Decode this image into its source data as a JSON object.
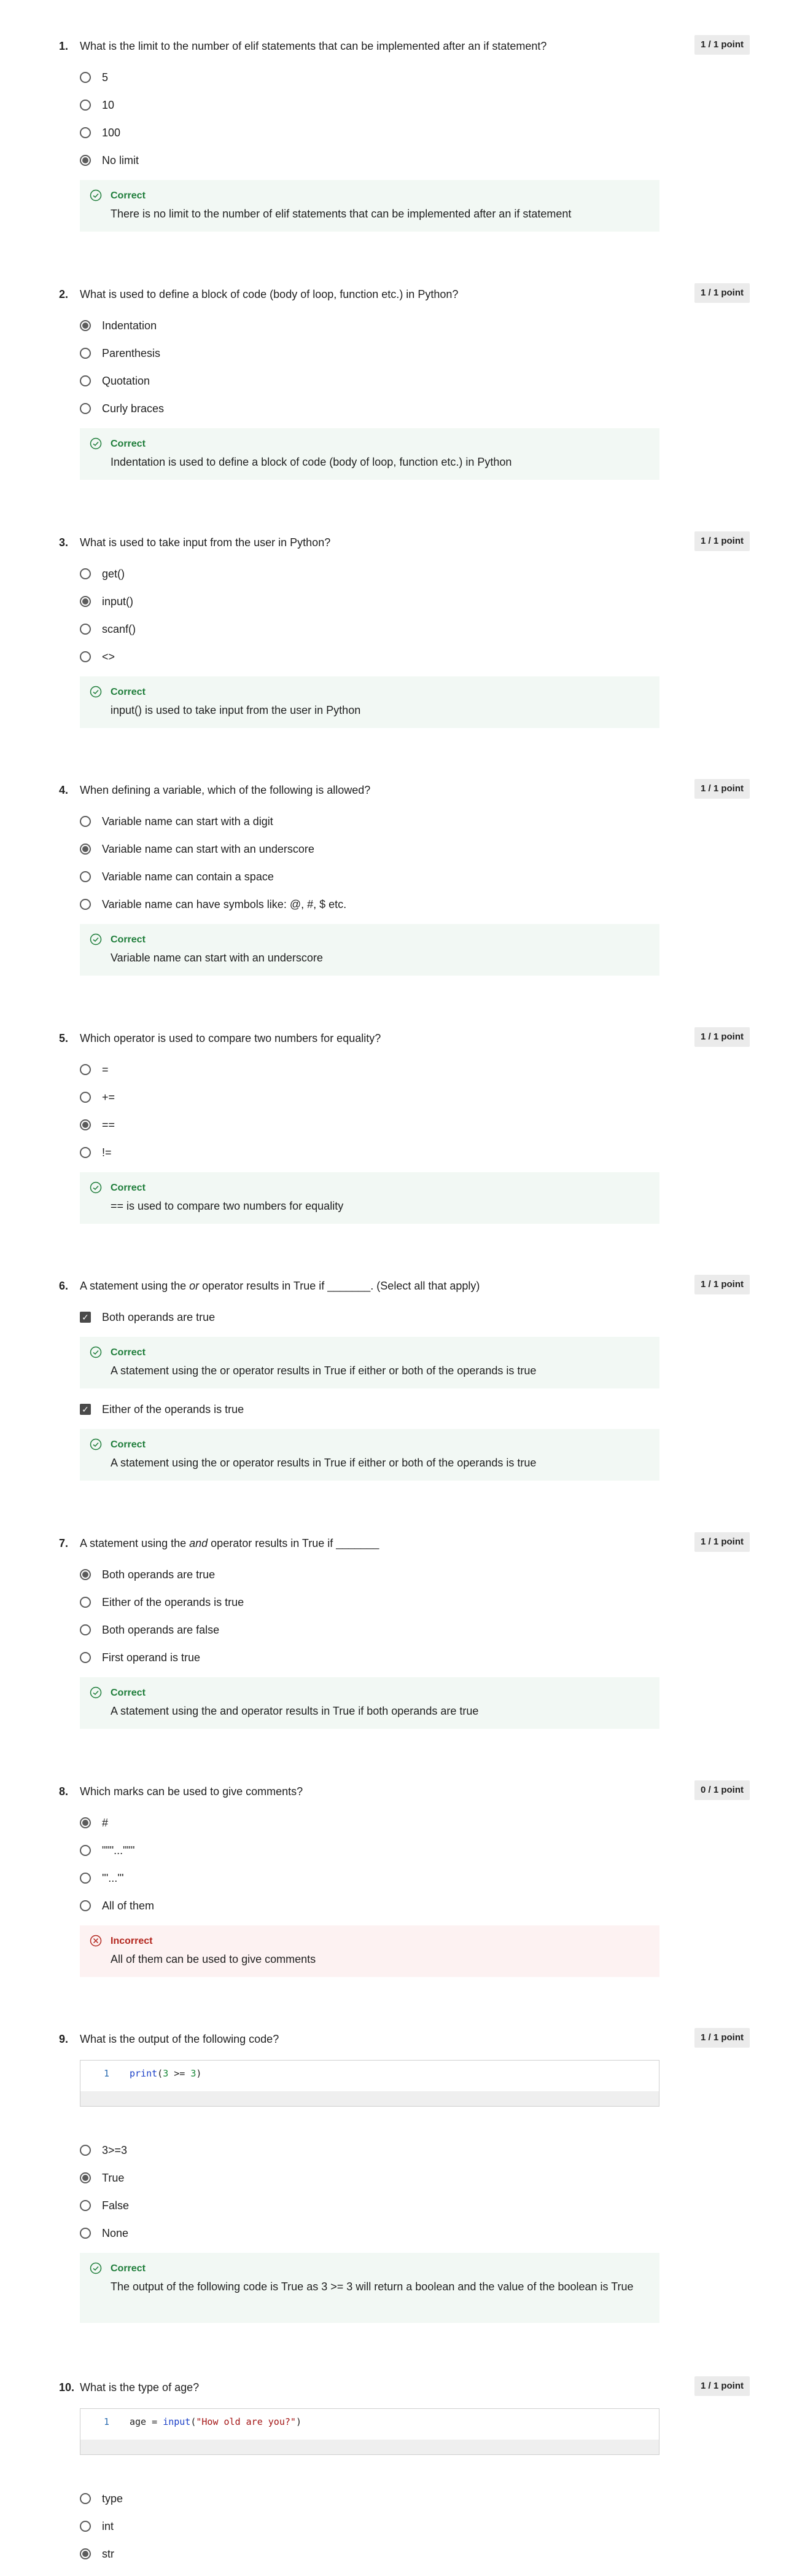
{
  "questions": [
    {
      "number": "1.",
      "text": "What is the limit to the number of elif statements that can be implemented after an if statement?",
      "points": "1 / 1 point",
      "options": [
        "5",
        "10",
        "100",
        "No limit"
      ],
      "feedback": {
        "status": "Correct",
        "text": "There is no limit to the number of elif statements that can be implemented after an if statement"
      }
    },
    {
      "number": "2.",
      "text": "What is used to define a block of code (body of loop, function etc.) in Python?",
      "points": "1 / 1 point",
      "options": [
        "Indentation",
        "Parenthesis",
        "Quotation",
        "Curly braces"
      ],
      "feedback": {
        "status": "Correct",
        "text": "Indentation is used to define a block of code (body of loop, function etc.) in Python"
      }
    },
    {
      "number": "3.",
      "text": "What is used to take input from the user in Python?",
      "points": "1 / 1 point",
      "options": [
        "get()",
        "input()",
        "scanf()",
        "<>"
      ],
      "feedback": {
        "status": "Correct",
        "text": "input() is used to take input from the user in Python"
      }
    },
    {
      "number": "4.",
      "text": "When defining a variable, which of the following is allowed?",
      "points": "1 / 1 point",
      "options": [
        "Variable name can start with a digit",
        "Variable name can start with an underscore",
        "Variable name can contain a space",
        "Variable name can have symbols like: @, #, $ etc."
      ],
      "feedback": {
        "status": "Correct",
        "text": "Variable name can start with an underscore"
      }
    },
    {
      "number": "5.",
      "text": "Which operator is used to compare two numbers for equality?",
      "points": "1 / 1 point",
      "options": [
        "=",
        "+=",
        "==",
        "!="
      ],
      "feedback": {
        "status": "Correct",
        "text": "== is used to compare two numbers for equality"
      }
    },
    {
      "number": "6.",
      "text_before": "A statement using the ",
      "text_em": "or",
      "text_after": " operator results in True if _______. (Select all that apply)",
      "points": "1 / 1 point",
      "options": [
        "Both operands are true",
        "Either of the operands is true"
      ],
      "feedback1": {
        "status": "Correct",
        "text": "A statement using the  or  operator results in True if either or both of the operands is true"
      },
      "feedback2": {
        "status": "Correct",
        "text": "A statement using the  or  operator results in True if either or both of the operands is true"
      }
    },
    {
      "number": "7.",
      "text_before": "A statement using the ",
      "text_em": "and",
      "text_after": " operator results in True if _______",
      "points": "1 / 1 point",
      "options": [
        "Both operands are true",
        "Either of the operands is true",
        "Both operands are false",
        "First operand is true"
      ],
      "feedback": {
        "status": "Correct",
        "text": "A statement using the  and  operator results in True if both operands are true"
      }
    },
    {
      "number": "8.",
      "text": "Which marks can be used to give comments?",
      "points": "0 / 1 point",
      "options": [
        "#",
        "\"\"\"...\"\"\"",
        "'''...'''",
        "All of them"
      ],
      "feedback": {
        "status": "Incorrect",
        "text": "All of them can be used to give comments"
      }
    },
    {
      "number": "9.",
      "text": "What is the output of the following code?",
      "points": "1 / 1 point",
      "code": {
        "line": "1",
        "fn": "print",
        "open": "(",
        "n1": "3",
        "op": " >= ",
        "n2": "3",
        "close": ")"
      },
      "options": [
        "3>=3",
        "True",
        "False",
        "None"
      ],
      "feedback": {
        "status": "Correct",
        "text": "The output of the following code is True as 3 >= 3 will return a boolean and the value of the boolean is True"
      }
    },
    {
      "number": "10.",
      "text": "What is the type of age?",
      "points": "1 / 1 point",
      "code": {
        "line": "1",
        "pre": "age = ",
        "fn": "input",
        "open": "(",
        "s": "\"How old are you?\"",
        "close": ")"
      },
      "options": [
        "type",
        "int",
        "str"
      ]
    }
  ],
  "colors": {
    "correct": "#1e7d3a",
    "incorrect": "#b3261e",
    "correct_bg": "#f2f8f4",
    "incorrect_bg": "#fdf2f2"
  }
}
